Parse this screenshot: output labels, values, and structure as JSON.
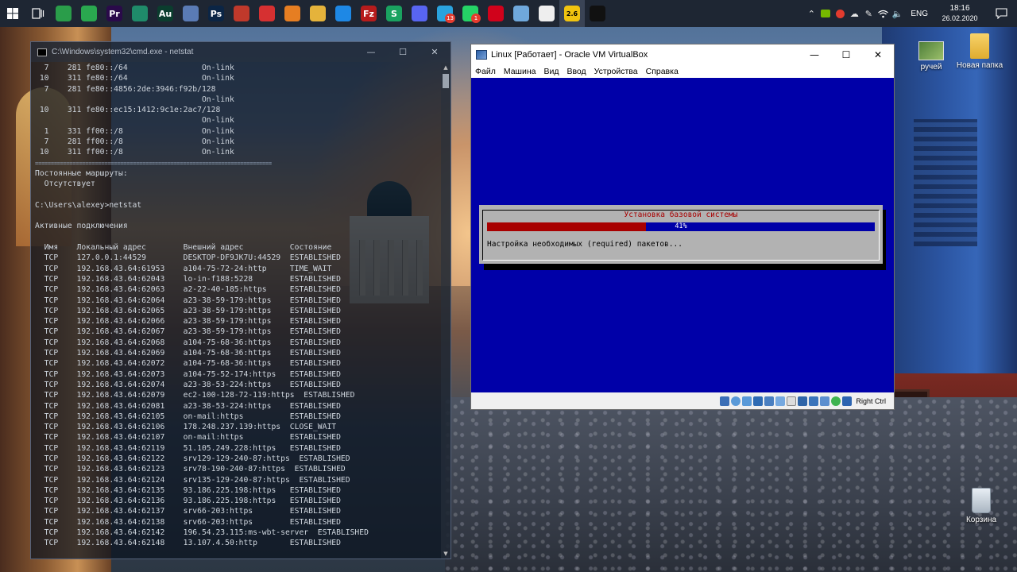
{
  "taskbar": {
    "apps": [
      {
        "name": "start-button",
        "glyph": "",
        "color": "#1e2633"
      },
      {
        "name": "task-view-button",
        "glyph": "",
        "color": "#1e2633"
      },
      {
        "name": "app-xbox",
        "glyph": "",
        "color": "#2a9d4a"
      },
      {
        "name": "app-maps",
        "glyph": "",
        "color": "#2aa84f"
      },
      {
        "name": "app-premiere",
        "glyph": "Pr",
        "color": "#2a0a4a"
      },
      {
        "name": "app-gamepad",
        "glyph": "",
        "color": "#1f8b6a"
      },
      {
        "name": "app-audition",
        "glyph": "Au",
        "color": "#0b3d2e"
      },
      {
        "name": "app-virtualbox-tb",
        "glyph": "",
        "color": "#5a7bb5"
      },
      {
        "name": "app-photoshop",
        "glyph": "Ps",
        "color": "#0b2545"
      },
      {
        "name": "app-paint",
        "glyph": "",
        "color": "#c0392b"
      },
      {
        "name": "app-speedtest",
        "glyph": "",
        "color": "#d63031"
      },
      {
        "name": "app-vlc",
        "glyph": "",
        "color": "#e67e22"
      },
      {
        "name": "app-explorer",
        "glyph": "",
        "color": "#e5b33b"
      },
      {
        "name": "app-vscode",
        "glyph": "",
        "color": "#1e88e5"
      },
      {
        "name": "app-filezilla",
        "glyph": "Fz",
        "color": "#b71c1c"
      },
      {
        "name": "app-skype-s",
        "glyph": "S",
        "color": "#1aa260"
      },
      {
        "name": "app-discord",
        "glyph": "",
        "color": "#5865f2"
      },
      {
        "name": "app-telegram",
        "glyph": "",
        "color": "#2aa3df",
        "badge": "13"
      },
      {
        "name": "app-whatsapp",
        "glyph": "",
        "color": "#25d366",
        "badge": "1"
      },
      {
        "name": "app-opera",
        "glyph": "",
        "color": "#d0021b"
      },
      {
        "name": "app-notes",
        "glyph": "",
        "color": "#6fa8dc"
      },
      {
        "name": "app-movies",
        "glyph": "",
        "color": "#eeeeee"
      },
      {
        "name": "app-linux-vm",
        "glyph": "2.6",
        "color": "#f1c40f",
        "active": true
      },
      {
        "name": "app-cmd",
        "glyph": "",
        "color": "#111111"
      }
    ],
    "tray": {
      "language": "ENG",
      "time": "18:16",
      "date": "26.02.2020"
    }
  },
  "desktop": {
    "icons": [
      {
        "label": "ручей"
      },
      {
        "label": "Новая папка"
      },
      {
        "label": "Корзина"
      }
    ]
  },
  "cmd": {
    "title": "C:\\Windows\\system32\\cmd.exe - netstat",
    "lines": [
      "  7    281 fe80::/64                Оn-link",
      " 10    311 fe80::/64                On-link",
      "  7    281 fe80::4856:2de:3946:f92b/128",
      "                                    On-link",
      " 10    311 fe80::ec15:1412:9c1e:2ac7/128",
      "                                    On-link",
      "  1    331 ff00::/8                 On-link",
      "  7    281 ff00::/8                 On-link",
      " 10    311 ff00::/8                 On-link",
      "===========================================================================",
      "Постоянные маршруты:",
      "  Отсутствует",
      "",
      "C:\\Users\\alexey>netstat",
      "",
      "Активные подключения",
      "",
      "  Имя    Локальный адрес        Внешний адрес          Состояние",
      "  TCP    127.0.0.1:44529        DESKTOP-DF9JK7U:44529  ESTABLISHED",
      "  TCP    192.168.43.64:61953    a104-75-72-24:http     TIME_WAIT",
      "  TCP    192.168.43.64:62043    lo-in-f188:5228        ESTABLISHED",
      "  TCP    192.168.43.64:62063    a2-22-40-185:https     ESTABLISHED",
      "  TCP    192.168.43.64:62064    a23-38-59-179:https    ESTABLISHED",
      "  TCP    192.168.43.64:62065    a23-38-59-179:https    ESTABLISHED",
      "  TCP    192.168.43.64:62066    a23-38-59-179:https    ESTABLISHED",
      "  TCP    192.168.43.64:62067    a23-38-59-179:https    ESTABLISHED",
      "  TCP    192.168.43.64:62068    a104-75-68-36:https    ESTABLISHED",
      "  TCP    192.168.43.64:62069    a104-75-68-36:https    ESTABLISHED",
      "  TCP    192.168.43.64:62072    a104-75-68-36:https    ESTABLISHED",
      "  TCP    192.168.43.64:62073    a104-75-52-174:https   ESTABLISHED",
      "  TCP    192.168.43.64:62074    a23-38-53-224:https    ESTABLISHED",
      "  TCP    192.168.43.64:62079    ec2-100-128-72-119:https  ESTABLISHED",
      "  TCP    192.168.43.64:62081    a23-38-53-224:https    ESTABLISHED",
      "  TCP    192.168.43.64:62105    on-mail:https          ESTABLISHED",
      "  TCP    192.168.43.64:62106    178.248.237.139:https  CLOSE_WAIT",
      "  TCP    192.168.43.64:62107    on-mail:https          ESTABLISHED",
      "  TCP    192.168.43.64:62119    51.105.249.228:https   ESTABLISHED",
      "  TCP    192.168.43.64:62122    srv129-129-240-87:https  ESTABLISHED",
      "  TCP    192.168.43.64:62123    srv78-190-240-87:https  ESTABLISHED",
      "  TCP    192.168.43.64:62124    srv135-129-240-87:https  ESTABLISHED",
      "  TCP    192.168.43.64:62135    93.186.225.198:https   ESTABLISHED",
      "  TCP    192.168.43.64:62136    93.186.225.198:https   ESTABLISHED",
      "  TCP    192.168.43.64:62137    srv66-203:https        ESTABLISHED",
      "  TCP    192.168.43.64:62138    srv66-203:https        ESTABLISHED",
      "  TCP    192.168.43.64:62142    196.54.23.115:ms-wbt-server  ESTABLISHED",
      "  TCP    192.168.43.64:62148    13.107.4.50:http       ESTABLISHED"
    ]
  },
  "vbox": {
    "title": "Linux [Работает] - Oracle VM VirtualBox",
    "menu": [
      "Файл",
      "Машина",
      "Вид",
      "Ввод",
      "Устройства",
      "Справка"
    ],
    "host_key": "Right Ctrl",
    "installer": {
      "title": "Установка базовой системы",
      "progress_percent": 41,
      "progress_label": "41%",
      "message": "Настройка необходимых (required) пакетов..."
    }
  },
  "colors": {
    "vm_screen": "#0000a8",
    "progress_fill": "#a80000",
    "dialog_bg": "#b2b2b2"
  }
}
